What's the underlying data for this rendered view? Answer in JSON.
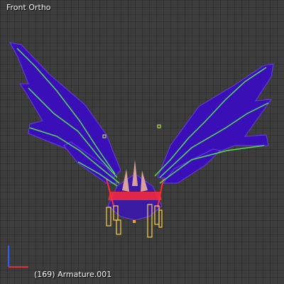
{
  "viewport": {
    "view_name": "Front Ortho",
    "status_text": "(169) Armature.001",
    "axis_labels": {
      "x": "x",
      "z": "z"
    }
  },
  "colors": {
    "background": "#3d3d3d",
    "mesh_fill": "#3a0fb8",
    "mesh_wire": "#6a3ee8",
    "bone_outline": "#55dd55",
    "bone_selected": "#ffd24a",
    "accent_red": "#ff2a3a",
    "horn": "#d9a0a0",
    "axis_x": "#e03030",
    "axis_z": "#3060ff"
  },
  "icons": [
    "wing-mesh-icon",
    "armature-icon",
    "origin-icon",
    "axis-gizmo-icon"
  ]
}
